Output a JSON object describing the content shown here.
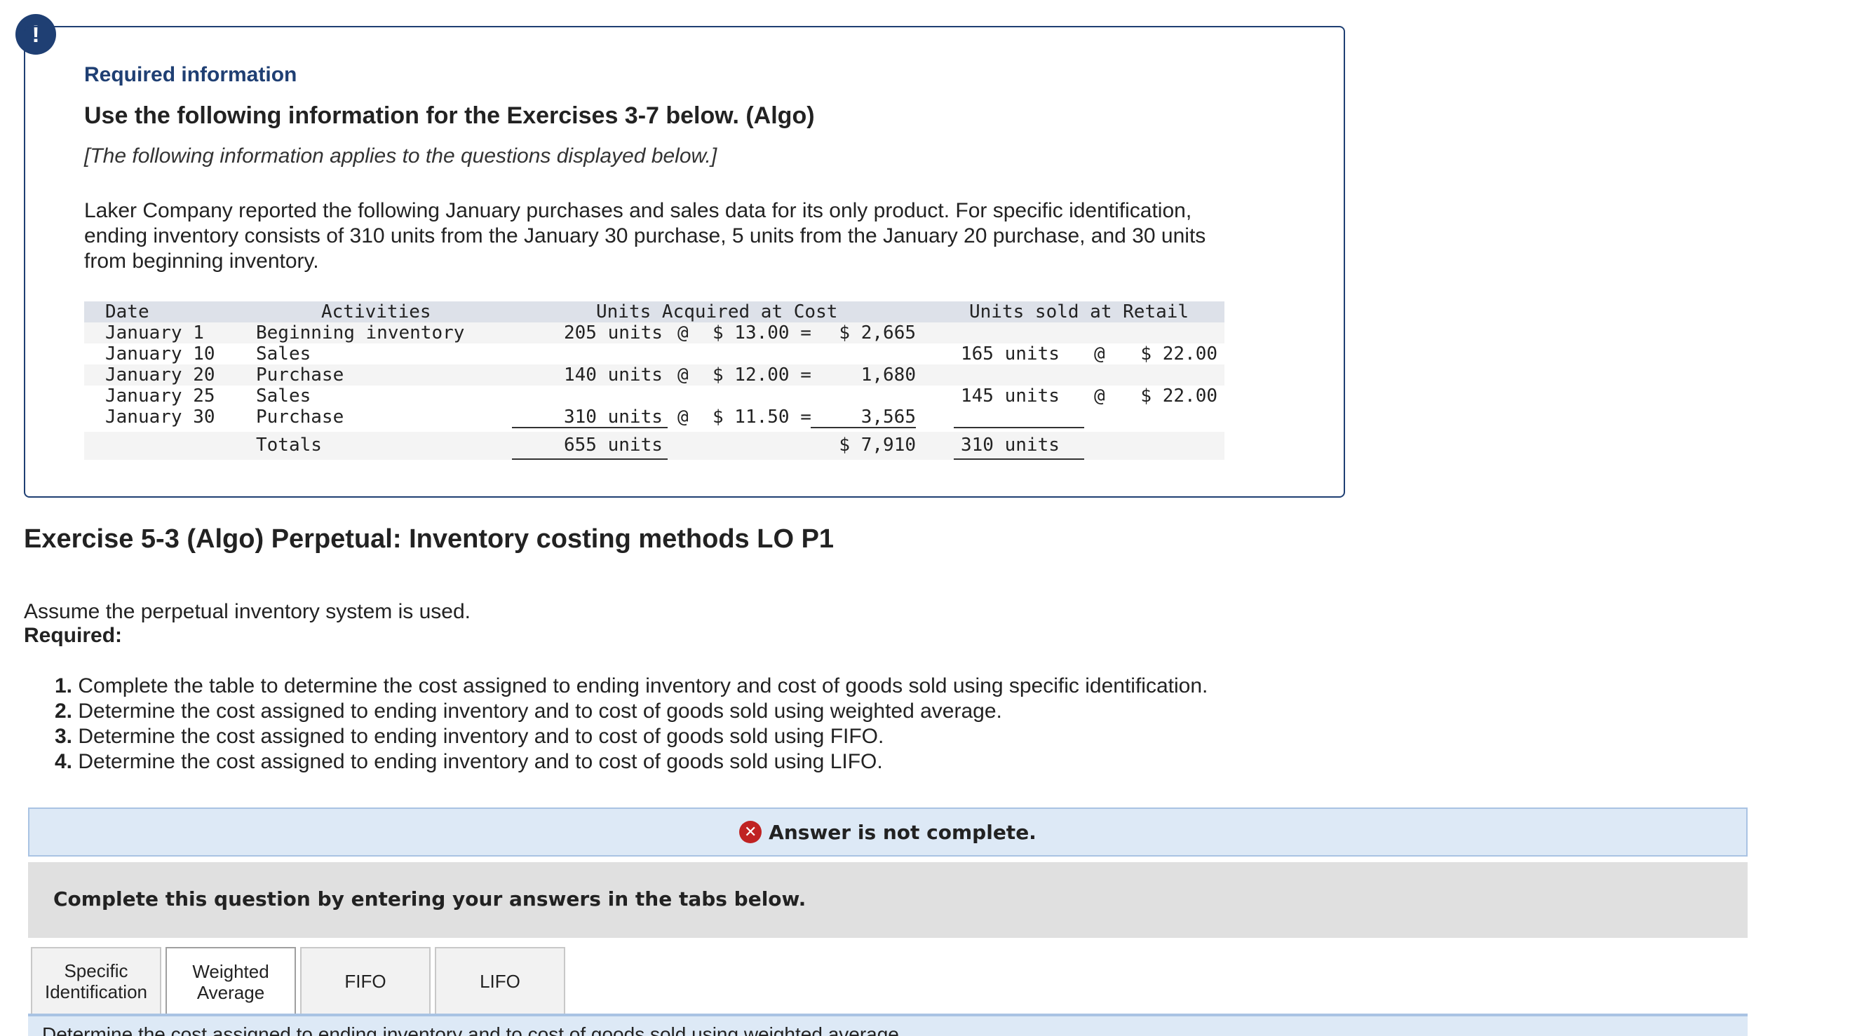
{
  "required_info": {
    "alert_symbol": "!",
    "heading": "Required information",
    "subheading": "Use the following information for the Exercises 3-7 below. (Algo)",
    "applies": "[The following information applies to the questions displayed below.]",
    "intro_line1": "Laker Company reported the following January purchases and sales data for its only product. For specific identification,",
    "intro_line2": "ending inventory consists of 310 units from the January 30 purchase, 5 units from the January 20 purchase, and 30 units",
    "intro_line3": "from beginning inventory."
  },
  "table": {
    "headers": {
      "date": "Date",
      "activities": "Activities",
      "acquired": "Units Acquired at Cost",
      "sold": "Units sold at Retail"
    },
    "rows": [
      {
        "date": "January 1",
        "activity": "Beginning inventory",
        "acq_units": "205 units",
        "acq_at": "@",
        "acq_cost": "$ 13.00 =",
        "acq_total": "$ 2,665",
        "sold_units": "",
        "sold_at": "",
        "sold_price": ""
      },
      {
        "date": "January 10",
        "activity": "Sales",
        "acq_units": "",
        "acq_at": "",
        "acq_cost": "",
        "acq_total": "",
        "sold_units": "165 units",
        "sold_at": "@",
        "sold_price": "$ 22.00"
      },
      {
        "date": "January 20",
        "activity": "Purchase",
        "acq_units": "140 units",
        "acq_at": "@",
        "acq_cost": "$ 12.00 =",
        "acq_total": "1,680",
        "sold_units": "",
        "sold_at": "",
        "sold_price": ""
      },
      {
        "date": "January 25",
        "activity": "Sales",
        "acq_units": "",
        "acq_at": "",
        "acq_cost": "",
        "acq_total": "",
        "sold_units": "145 units",
        "sold_at": "@",
        "sold_price": "$ 22.00"
      },
      {
        "date": "January 30",
        "activity": "Purchase",
        "acq_units": "310 units",
        "acq_at": "@",
        "acq_cost": "$ 11.50 =",
        "acq_total": "3,565",
        "sold_units": "",
        "sold_at": "",
        "sold_price": ""
      }
    ],
    "totals": {
      "label": "Totals",
      "acq_units": "655 units",
      "acq_total": "$ 7,910",
      "sold_units": "310 units"
    }
  },
  "exercise": {
    "title": "Exercise 5-3 (Algo) Perpetual: Inventory costing methods LO P1",
    "assume": "Assume the perpetual inventory system is used.",
    "required_label": "Required:",
    "requirements": [
      {
        "num": "1.",
        "text": "Complete the table to determine the cost assigned to ending inventory and cost of goods sold using specific identification."
      },
      {
        "num": "2.",
        "text": "Determine the cost assigned to ending inventory and to cost of goods sold using weighted average."
      },
      {
        "num": "3.",
        "text": "Determine the cost assigned to ending inventory and to cost of goods sold using FIFO."
      },
      {
        "num": "4.",
        "text": "Determine the cost assigned to ending inventory and to cost of goods sold using LIFO."
      }
    ]
  },
  "answer_status": {
    "icon": "x-circle-icon",
    "icon_glyph": "✕",
    "text": "Answer is not complete."
  },
  "instructions": "Complete this question by entering your answers in the tabs below.",
  "tabs": [
    {
      "label_line1": "Specific",
      "label_line2": "Identification",
      "active": false
    },
    {
      "label_line1": "Weighted",
      "label_line2": "Average",
      "active": true
    },
    {
      "label_line1": "FIFO",
      "label_line2": "",
      "active": false
    },
    {
      "label_line1": "LIFO",
      "label_line2": "",
      "active": false
    }
  ],
  "tab_content_text": "Determine the cost assigned to ending inventory and to cost of goods sold using weighted average.",
  "colors": {
    "brand_navy": "#1f3f73",
    "error_red": "#c02323",
    "banner_blue": "#dde9f6"
  }
}
